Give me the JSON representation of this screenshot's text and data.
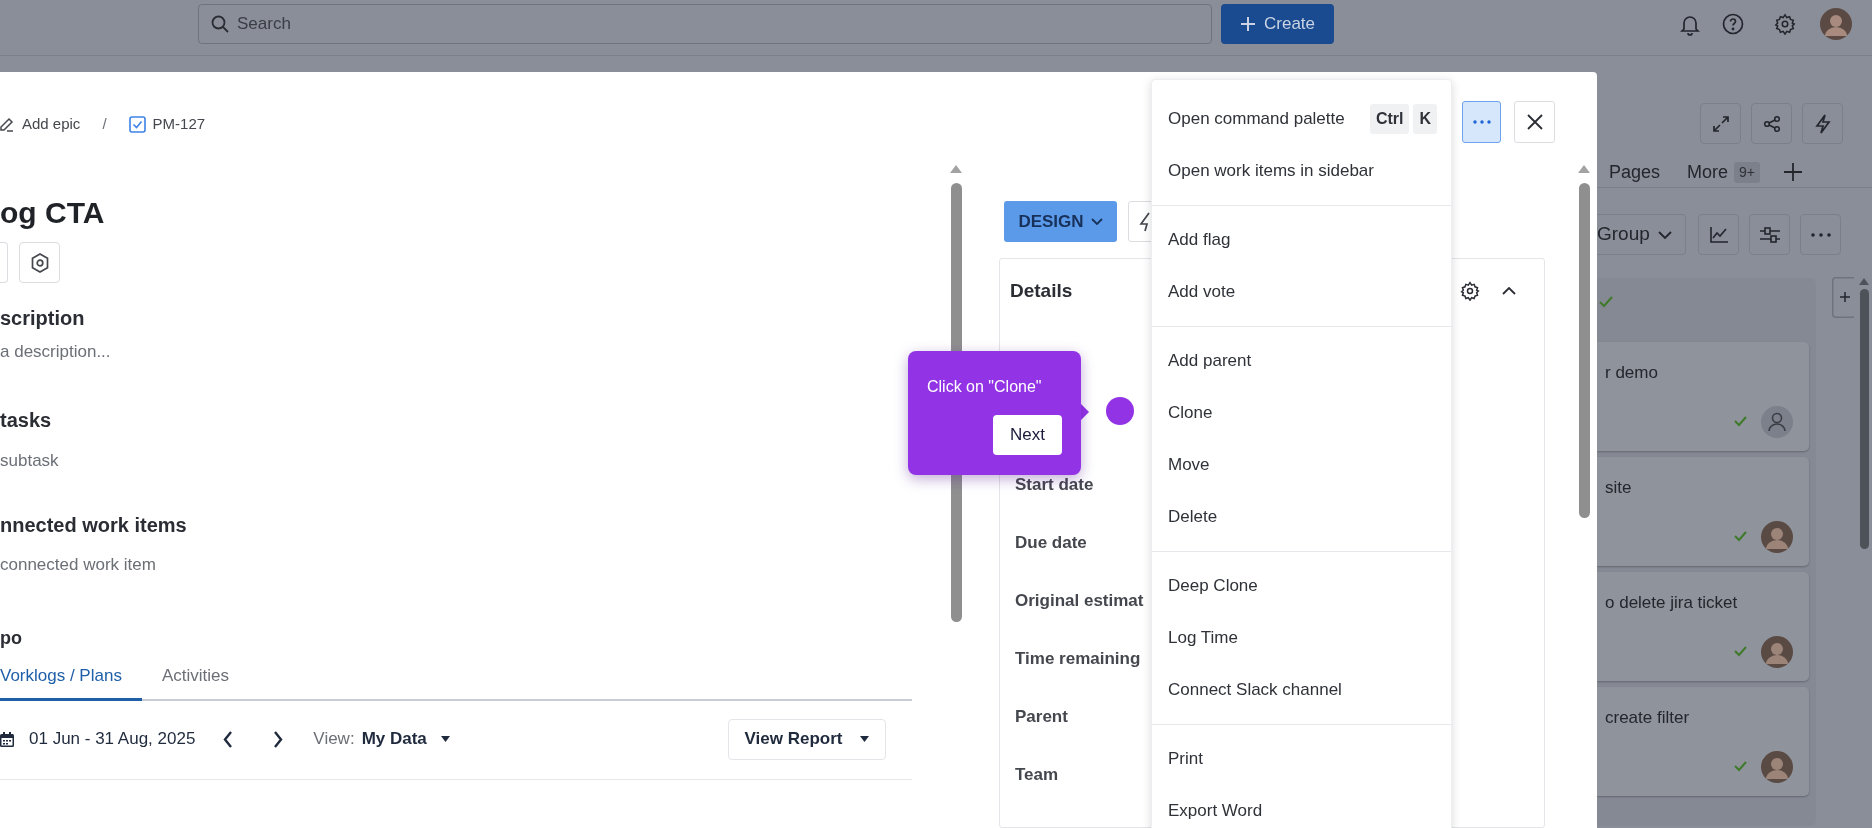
{
  "top_bar": {
    "search_placeholder": "Search",
    "create_button": "Create"
  },
  "board": {
    "tabs": [
      {
        "label": "Pages",
        "selected": false
      },
      {
        "label": "More",
        "badge": "9+",
        "selected": false
      }
    ],
    "group_button": "Group",
    "cards": [
      {
        "title": "r demo",
        "kind": "unassigned"
      },
      {
        "title": "site",
        "kind": "person"
      },
      {
        "title": "o delete jira ticket",
        "kind": "person"
      },
      {
        "title": "create filter",
        "kind": "person"
      }
    ]
  },
  "modal": {
    "breadcrumb_separator": "/",
    "breadcrumb": [
      {
        "label": "Add epic",
        "kind": "epic"
      },
      {
        "label": "PM-127",
        "kind": "task"
      }
    ],
    "title": "og CTA",
    "sections": [
      {
        "heading": "scription",
        "placeholder": "a description..."
      },
      {
        "heading": "tasks",
        "placeholder": "subtask"
      },
      {
        "heading": "nnected work items",
        "placeholder": "connected work item"
      }
    ],
    "panel_heading": "po",
    "tabs": [
      {
        "label": "Vorklogs / Plans",
        "selected": true
      },
      {
        "label": "Activities",
        "selected": false
      }
    ],
    "date_range": "01 Jun - 31 Aug, 2025",
    "view_label": "View:",
    "view_value": "My Data",
    "report_button": "View Report",
    "status_button": "DESIGN",
    "details": {
      "heading": "Details",
      "fields": [
        "Start date",
        "Due date",
        "Original estimat",
        "Time remaining",
        "Parent",
        "Team"
      ]
    }
  },
  "menu": {
    "groups": [
      [
        {
          "label": "Open command palette",
          "keys": [
            "Ctrl",
            "K"
          ]
        },
        {
          "label": "Open work items in sidebar"
        }
      ],
      [
        {
          "label": "Add flag"
        },
        {
          "label": "Add vote"
        }
      ],
      [
        {
          "label": "Add parent"
        },
        {
          "label": "Clone"
        },
        {
          "label": "Move"
        },
        {
          "label": "Delete"
        }
      ],
      [
        {
          "label": "Deep Clone"
        },
        {
          "label": "Log Time"
        },
        {
          "label": "Connect Slack channel"
        }
      ],
      [
        {
          "label": "Print"
        },
        {
          "label": "Export Word"
        }
      ]
    ]
  },
  "tooltip": {
    "text": "Click on \"Clone\"",
    "button": "Next"
  }
}
